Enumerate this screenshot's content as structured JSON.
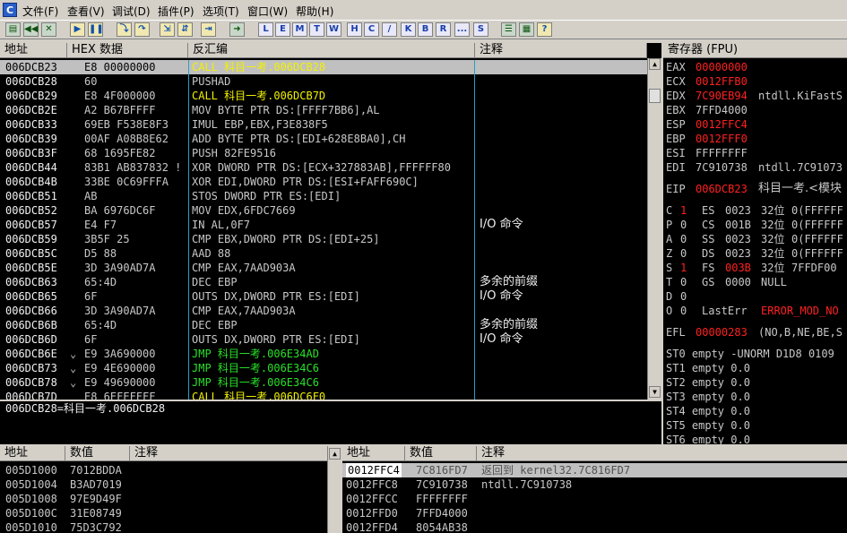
{
  "app": {
    "icon_letter": "C"
  },
  "menu": [
    "文件(F)",
    "查看(V)",
    "调试(D)",
    "插件(P)",
    "选项(T)",
    "窗口(W)",
    "帮助(H)"
  ],
  "toolbar": {
    "left_buttons": [
      "open",
      "rewind",
      "close",
      "run",
      "pause",
      "step-into",
      "step-over",
      "trace-into",
      "trace-over",
      "execute-till-return",
      "go-to"
    ],
    "letter_buttons": [
      "L",
      "E",
      "M",
      "T",
      "W",
      "H",
      "C",
      "/",
      "K",
      "B",
      "R",
      "...",
      "S"
    ],
    "right_buttons": [
      "list",
      "grid",
      "help"
    ]
  },
  "disasm": {
    "headers": {
      "address": "地址",
      "hex": "HEX 数据",
      "disasm": "反汇编",
      "comment": "注释"
    },
    "rows": [
      {
        "addr": "006DCB23",
        "mark": "",
        "hex": "E8 00000000",
        "asm": "CALL 科目一考.006DCB28",
        "comment": "",
        "style": "call",
        "selected": true
      },
      {
        "addr": "006DCB28",
        "mark": "",
        "hex": "60",
        "asm": "PUSHAD",
        "comment": "",
        "style": ""
      },
      {
        "addr": "006DCB29",
        "mark": "",
        "hex": "E8 4F000000",
        "asm": "CALL 科目一考.006DCB7D",
        "comment": "",
        "style": "call"
      },
      {
        "addr": "006DCB2E",
        "mark": "",
        "hex": "A2 B67BFFFF",
        "asm": "MOV BYTE PTR DS:[FFFF7BB6],AL",
        "comment": "",
        "style": ""
      },
      {
        "addr": "006DCB33",
        "mark": "",
        "hex": "69EB F538E8F3",
        "asm": "IMUL EBP,EBX,F3E838F5",
        "comment": "",
        "style": ""
      },
      {
        "addr": "006DCB39",
        "mark": "",
        "hex": "00AF A08B8E62",
        "asm": "ADD BYTE PTR DS:[EDI+628E8BA0],CH",
        "comment": "",
        "style": ""
      },
      {
        "addr": "006DCB3F",
        "mark": "",
        "hex": "68 1695FE82",
        "asm": "PUSH 82FE9516",
        "comment": "",
        "style": ""
      },
      {
        "addr": "006DCB44",
        "mark": "",
        "hex": "83B1 AB837832 !",
        "asm": "XOR DWORD PTR DS:[ECX+327883AB],FFFFFF80",
        "comment": "",
        "style": ""
      },
      {
        "addr": "006DCB4B",
        "mark": "",
        "hex": "33BE 0C69FFFA",
        "asm": "XOR EDI,DWORD PTR DS:[ESI+FAFF690C]",
        "comment": "",
        "style": ""
      },
      {
        "addr": "006DCB51",
        "mark": "",
        "hex": "AB",
        "asm": "STOS DWORD PTR ES:[EDI]",
        "comment": "",
        "style": ""
      },
      {
        "addr": "006DCB52",
        "mark": "",
        "hex": "BA 6976DC6F",
        "asm": "MOV EDX,6FDC7669",
        "comment": "",
        "style": ""
      },
      {
        "addr": "006DCB57",
        "mark": "",
        "hex": "E4 F7",
        "asm": "IN AL,0F7",
        "comment": "I/O 命令",
        "style": ""
      },
      {
        "addr": "006DCB59",
        "mark": "",
        "hex": "3B5F 25",
        "asm": "CMP EBX,DWORD PTR DS:[EDI+25]",
        "comment": "",
        "style": ""
      },
      {
        "addr": "006DCB5C",
        "mark": "",
        "hex": "D5 88",
        "asm": "AAD 88",
        "comment": "",
        "style": ""
      },
      {
        "addr": "006DCB5E",
        "mark": "",
        "hex": "3D 3A90AD7A",
        "asm": "CMP EAX,7AAD903A",
        "comment": "",
        "style": ""
      },
      {
        "addr": "006DCB63",
        "mark": "",
        "hex": "65:4D",
        "asm": "DEC EBP",
        "comment": "多余的前缀",
        "style": ""
      },
      {
        "addr": "006DCB65",
        "mark": "",
        "hex": "6F",
        "asm": "OUTS DX,DWORD PTR ES:[EDI]",
        "comment": "I/O 命令",
        "style": ""
      },
      {
        "addr": "006DCB66",
        "mark": "",
        "hex": "3D 3A90AD7A",
        "asm": "CMP EAX,7AAD903A",
        "comment": "",
        "style": ""
      },
      {
        "addr": "006DCB6B",
        "mark": "",
        "hex": "65:4D",
        "asm": "DEC EBP",
        "comment": "多余的前缀",
        "style": ""
      },
      {
        "addr": "006DCB6D",
        "mark": "",
        "hex": "6F",
        "asm": "OUTS DX,DWORD PTR ES:[EDI]",
        "comment": "I/O 命令",
        "style": ""
      },
      {
        "addr": "006DCB6E",
        "mark": "⌄",
        "hex": "E9 3A690000",
        "asm": "JMP 科目一考.006E34AD",
        "comment": "",
        "style": "jmp"
      },
      {
        "addr": "006DCB73",
        "mark": "⌄",
        "hex": "E9 4E690000",
        "asm": "JMP 科目一考.006E34C6",
        "comment": "",
        "style": "jmp"
      },
      {
        "addr": "006DCB78",
        "mark": "⌄",
        "hex": "E9 49690000",
        "asm": "JMP 科目一考.006E34C6",
        "comment": "",
        "style": "jmp"
      },
      {
        "addr": "006DCB7D",
        "mark": "",
        "hex": "E8 6EFEFFFF",
        "asm": "CALL 科目一考.006DC6F0",
        "comment": "",
        "style": "call"
      }
    ]
  },
  "info_line": "006DCB28=科目一考.006DCB28",
  "registers": {
    "title": "寄存器 (FPU)",
    "rows": [
      {
        "name": "EAX",
        "value": "00000000",
        "extra": "",
        "changed": true
      },
      {
        "name": "ECX",
        "value": "0012FFB0",
        "extra": "",
        "changed": true
      },
      {
        "name": "EDX",
        "value": "7C90EB94",
        "extra": "ntdll.KiFastS",
        "changed": true
      },
      {
        "name": "EBX",
        "value": "7FFD4000",
        "extra": "",
        "changed": false
      },
      {
        "name": "ESP",
        "value": "0012FFC4",
        "extra": "",
        "changed": true
      },
      {
        "name": "EBP",
        "value": "0012FFF0",
        "extra": "",
        "changed": true
      },
      {
        "name": "ESI",
        "value": "FFFFFFFF",
        "extra": "",
        "changed": false
      },
      {
        "name": "EDI",
        "value": "7C910738",
        "extra": "ntdll.7C91073",
        "changed": false
      }
    ],
    "eip": {
      "name": "EIP",
      "value": "006DCB23",
      "extra": "科目一考.<模块"
    },
    "flags": [
      {
        "flag": "C",
        "bit": "1",
        "seg": "ES",
        "sel": "0023",
        "bits": "32位",
        "base": "0(FFFFFF",
        "bit_changed": true,
        "sel_changed": false
      },
      {
        "flag": "P",
        "bit": "0",
        "seg": "CS",
        "sel": "001B",
        "bits": "32位",
        "base": "0(FFFFFF",
        "bit_changed": false,
        "sel_changed": false
      },
      {
        "flag": "A",
        "bit": "0",
        "seg": "SS",
        "sel": "0023",
        "bits": "32位",
        "base": "0(FFFFFF",
        "bit_changed": false,
        "sel_changed": false
      },
      {
        "flag": "Z",
        "bit": "0",
        "seg": "DS",
        "sel": "0023",
        "bits": "32位",
        "base": "0(FFFFFF",
        "bit_changed": false,
        "sel_changed": false
      },
      {
        "flag": "S",
        "bit": "1",
        "seg": "FS",
        "sel": "003B",
        "bits": "32位",
        "base": "7FFDF00",
        "bit_changed": true,
        "sel_changed": true
      },
      {
        "flag": "T",
        "bit": "0",
        "seg": "GS",
        "sel": "0000",
        "bits": "NULL",
        "base": "",
        "bit_changed": false,
        "sel_changed": false
      },
      {
        "flag": "D",
        "bit": "0",
        "seg": "",
        "sel": "",
        "bits": "",
        "base": "",
        "bit_changed": false,
        "sel_changed": false
      },
      {
        "flag": "O",
        "bit": "0",
        "seg": "LastErr",
        "sel": "",
        "bits": "ERROR_MOD_NO",
        "base": "",
        "bit_changed": false,
        "sel_changed": false,
        "lasterr": true
      }
    ],
    "efl": {
      "name": "EFL",
      "value": "00000283",
      "extra": "(NO,B,NE,BE,S"
    },
    "fpu": [
      "ST0 empty -UNORM D1D8 0109",
      "ST1 empty 0.0",
      "ST2 empty 0.0",
      "ST3 empty 0.0",
      "ST4 empty 0.0",
      "ST5 empty 0.0",
      "ST6 empty 0.0"
    ]
  },
  "dump": {
    "headers": {
      "address": "地址",
      "value": "数值",
      "comment": "注释"
    },
    "rows": [
      {
        "addr": "005D1000",
        "value": "7012BDDA"
      },
      {
        "addr": "005D1004",
        "value": "B3AD7019"
      },
      {
        "addr": "005D1008",
        "value": "97E9D49F"
      },
      {
        "addr": "005D100C",
        "value": "31E08749"
      },
      {
        "addr": "005D1010",
        "value": "75D3C792"
      }
    ]
  },
  "stack": {
    "headers": {
      "address": "地址",
      "value": "数值",
      "comment": "注释"
    },
    "rows": [
      {
        "addr": "0012FFC4",
        "value": "7C816FD7",
        "comment": "返回到 kernel32.7C816FD7",
        "selected": true
      },
      {
        "addr": "0012FFC8",
        "value": "7C910738",
        "comment": "ntdll.7C910738"
      },
      {
        "addr": "0012FFCC",
        "value": "FFFFFFFF",
        "comment": ""
      },
      {
        "addr": "0012FFD0",
        "value": "7FFD4000",
        "comment": ""
      },
      {
        "addr": "0012FFD4",
        "value": "8054AB38",
        "comment": ""
      }
    ]
  }
}
